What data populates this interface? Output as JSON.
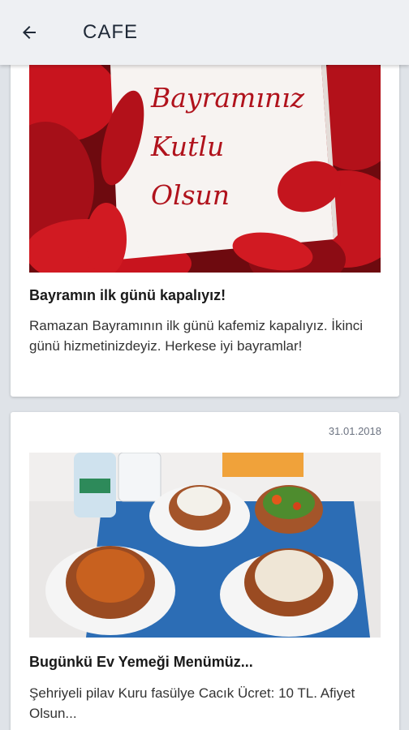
{
  "appbar": {
    "title": "CAFE",
    "back_icon": "arrow-left-icon"
  },
  "posts": [
    {
      "image_text": [
        "Bayramınız",
        "Kutlu",
        "Olsun"
      ],
      "title": "Bayramın ilk günü kapalıyız!",
      "body": "Ramazan Bayramının ilk günü kafemiz kapalıyız. İkinci günü hizmetinizdeyiz. Herkese iyi bayramlar!"
    },
    {
      "date": "31.01.2018",
      "title": "Bugünkü Ev Yemeği Menümüz...",
      "body": "Şehriyeli pilav Kuru fasülye Cacık Ücret: 10 TL. Afiyet Olsun..."
    }
  ],
  "colors": {
    "appbar_bg": "#eef0f3",
    "page_bg": "#dfe3e8",
    "card_bg": "#ffffff"
  }
}
